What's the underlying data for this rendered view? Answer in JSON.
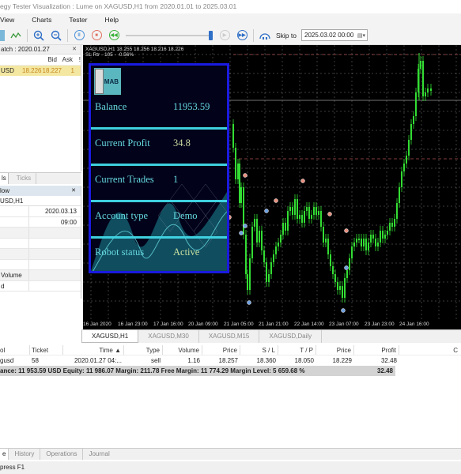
{
  "window": {
    "title": "egy Tester Visualization : Lume on XAGUSD,H1 from 2020.01.01 to 2025.03.01"
  },
  "menu": [
    "View",
    "Charts",
    "Tester",
    "Help"
  ],
  "toolbar": {
    "skip_label": "Skip to",
    "skip_date": "2025.03.02 00:00",
    "speed_fraction": 1.0
  },
  "market_watch": {
    "title": "atch : 2020.01.27",
    "columns": [
      "Bid",
      "Ask",
      "!"
    ],
    "rows": [
      {
        "symbol": "USD",
        "bid": "18.226",
        "ask": "18.227",
        "flag": "1"
      }
    ]
  },
  "left_tabs": [
    "ls",
    "Ticks"
  ],
  "data_window": {
    "title": "low",
    "symbol": "USD,H1",
    "rows": [
      {
        "label": "",
        "value": "2020.03.13"
      },
      {
        "label": "",
        "value": "09:00"
      },
      {
        "label": "",
        "value": ""
      },
      {
        "label": "",
        "value": ""
      },
      {
        "label": "",
        "value": ""
      },
      {
        "label": "",
        "value": ""
      },
      {
        "label": "Volume",
        "value": ""
      },
      {
        "label": "d",
        "value": ""
      }
    ]
  },
  "chart": {
    "info_line1": "XAGUSD,H1  18.255  18.256  18.216  18.226",
    "info_line2": "SL Rtr - 105 - -0.56%",
    "colors": {
      "background": "#000000",
      "bull": "#33dd33",
      "grid": "#cccccc"
    },
    "x_labels": [
      "16 Jan 2020",
      "16 Jan 23:00",
      "17 Jan 16:00",
      "20 Jan 09:00",
      "21 Jan 05:00",
      "21 Jan 21:00",
      "22 Jan 14:00",
      "23 Jan 07:00",
      "23 Jan 23:00",
      "24 Jan 16:00"
    ],
    "tabs": [
      "XAGUSD,H1",
      "XAGUSD,M30",
      "XAGUSD,M15",
      "XAGUSD,Daily"
    ],
    "active_tab": 0
  },
  "mab_panel": {
    "logo_text": "MAB",
    "rows": [
      {
        "label": "Balance",
        "value": "11953.59"
      },
      {
        "label": "Current Profit",
        "value": "34.8"
      },
      {
        "label": "Current Trades",
        "value": "1"
      },
      {
        "label": "Account type",
        "value": "Demo"
      },
      {
        "label": "Robot status",
        "value": "Active"
      }
    ]
  },
  "trades": {
    "columns": [
      "ol",
      "Ticket",
      "Time",
      "Type",
      "Volume",
      "Price",
      "S / L",
      "T / P",
      "Price",
      "Profit",
      "C"
    ],
    "rows": [
      {
        "symbol": "gusd",
        "ticket": "58",
        "time": "2020.01.27 04:...",
        "type": "sell",
        "volume": "1.16",
        "price": "18.257",
        "sl": "18.360",
        "tp": "18.050",
        "price2": "18.229",
        "profit": "32.48"
      }
    ],
    "summary": "ance: 11 953.59 USD  Equity: 11 986.07  Margin: 211.78  Free Margin: 11 774.29  Margin Level: 5 659.68 %",
    "summary_profit": "32.48"
  },
  "bottom_tabs": [
    "e",
    "History",
    "Operations",
    "Journal"
  ],
  "status": "press F1"
}
